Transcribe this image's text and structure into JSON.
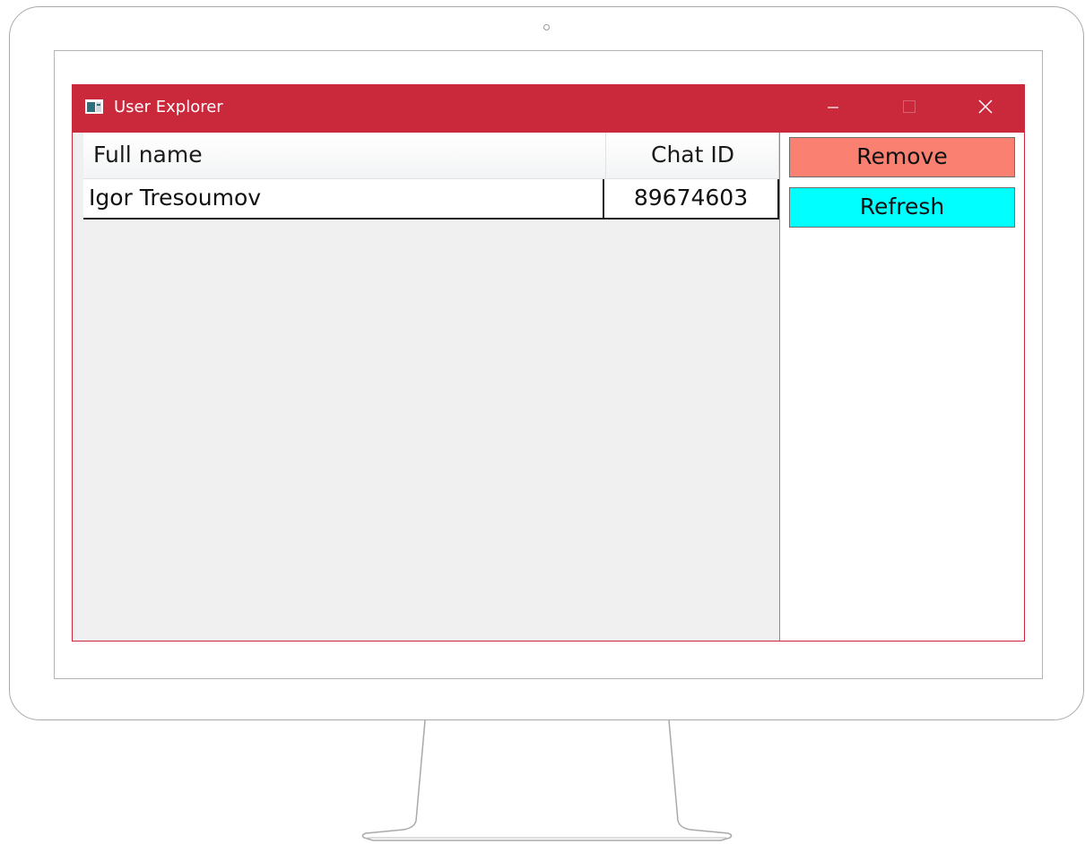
{
  "window": {
    "title": "User Explorer",
    "title_bar_color": "#ca283b"
  },
  "icons": {
    "app": "window-app-icon",
    "minimize": "minimize-icon",
    "maximize": "maximize-icon",
    "close": "close-icon"
  },
  "grid": {
    "columns": [
      "Full name",
      "Chat ID"
    ],
    "rows": [
      {
        "full_name": "Igor Tresoumov",
        "chat_id": "89674603"
      }
    ]
  },
  "actions": {
    "remove_label": "Remove",
    "remove_color": "#fa8072",
    "refresh_label": "Refresh",
    "refresh_color": "#00ffff"
  }
}
